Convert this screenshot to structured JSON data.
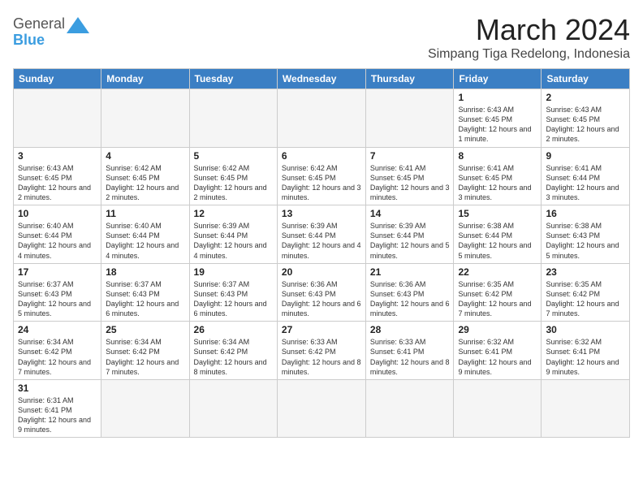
{
  "header": {
    "logo_general": "General",
    "logo_blue": "Blue",
    "month_title": "March 2024",
    "location": "Simpang Tiga Redelong, Indonesia"
  },
  "weekdays": [
    "Sunday",
    "Monday",
    "Tuesday",
    "Wednesday",
    "Thursday",
    "Friday",
    "Saturday"
  ],
  "weeks": [
    [
      {
        "day": "",
        "info": ""
      },
      {
        "day": "",
        "info": ""
      },
      {
        "day": "",
        "info": ""
      },
      {
        "day": "",
        "info": ""
      },
      {
        "day": "",
        "info": ""
      },
      {
        "day": "1",
        "info": "Sunrise: 6:43 AM\nSunset: 6:45 PM\nDaylight: 12 hours and 1 minute."
      },
      {
        "day": "2",
        "info": "Sunrise: 6:43 AM\nSunset: 6:45 PM\nDaylight: 12 hours and 2 minutes."
      }
    ],
    [
      {
        "day": "3",
        "info": "Sunrise: 6:43 AM\nSunset: 6:45 PM\nDaylight: 12 hours and 2 minutes."
      },
      {
        "day": "4",
        "info": "Sunrise: 6:42 AM\nSunset: 6:45 PM\nDaylight: 12 hours and 2 minutes."
      },
      {
        "day": "5",
        "info": "Sunrise: 6:42 AM\nSunset: 6:45 PM\nDaylight: 12 hours and 2 minutes."
      },
      {
        "day": "6",
        "info": "Sunrise: 6:42 AM\nSunset: 6:45 PM\nDaylight: 12 hours and 3 minutes."
      },
      {
        "day": "7",
        "info": "Sunrise: 6:41 AM\nSunset: 6:45 PM\nDaylight: 12 hours and 3 minutes."
      },
      {
        "day": "8",
        "info": "Sunrise: 6:41 AM\nSunset: 6:45 PM\nDaylight: 12 hours and 3 minutes."
      },
      {
        "day": "9",
        "info": "Sunrise: 6:41 AM\nSunset: 6:44 PM\nDaylight: 12 hours and 3 minutes."
      }
    ],
    [
      {
        "day": "10",
        "info": "Sunrise: 6:40 AM\nSunset: 6:44 PM\nDaylight: 12 hours and 4 minutes."
      },
      {
        "day": "11",
        "info": "Sunrise: 6:40 AM\nSunset: 6:44 PM\nDaylight: 12 hours and 4 minutes."
      },
      {
        "day": "12",
        "info": "Sunrise: 6:39 AM\nSunset: 6:44 PM\nDaylight: 12 hours and 4 minutes."
      },
      {
        "day": "13",
        "info": "Sunrise: 6:39 AM\nSunset: 6:44 PM\nDaylight: 12 hours and 4 minutes."
      },
      {
        "day": "14",
        "info": "Sunrise: 6:39 AM\nSunset: 6:44 PM\nDaylight: 12 hours and 5 minutes."
      },
      {
        "day": "15",
        "info": "Sunrise: 6:38 AM\nSunset: 6:44 PM\nDaylight: 12 hours and 5 minutes."
      },
      {
        "day": "16",
        "info": "Sunrise: 6:38 AM\nSunset: 6:43 PM\nDaylight: 12 hours and 5 minutes."
      }
    ],
    [
      {
        "day": "17",
        "info": "Sunrise: 6:37 AM\nSunset: 6:43 PM\nDaylight: 12 hours and 5 minutes."
      },
      {
        "day": "18",
        "info": "Sunrise: 6:37 AM\nSunset: 6:43 PM\nDaylight: 12 hours and 6 minutes."
      },
      {
        "day": "19",
        "info": "Sunrise: 6:37 AM\nSunset: 6:43 PM\nDaylight: 12 hours and 6 minutes."
      },
      {
        "day": "20",
        "info": "Sunrise: 6:36 AM\nSunset: 6:43 PM\nDaylight: 12 hours and 6 minutes."
      },
      {
        "day": "21",
        "info": "Sunrise: 6:36 AM\nSunset: 6:43 PM\nDaylight: 12 hours and 6 minutes."
      },
      {
        "day": "22",
        "info": "Sunrise: 6:35 AM\nSunset: 6:42 PM\nDaylight: 12 hours and 7 minutes."
      },
      {
        "day": "23",
        "info": "Sunrise: 6:35 AM\nSunset: 6:42 PM\nDaylight: 12 hours and 7 minutes."
      }
    ],
    [
      {
        "day": "24",
        "info": "Sunrise: 6:34 AM\nSunset: 6:42 PM\nDaylight: 12 hours and 7 minutes."
      },
      {
        "day": "25",
        "info": "Sunrise: 6:34 AM\nSunset: 6:42 PM\nDaylight: 12 hours and 7 minutes."
      },
      {
        "day": "26",
        "info": "Sunrise: 6:34 AM\nSunset: 6:42 PM\nDaylight: 12 hours and 8 minutes."
      },
      {
        "day": "27",
        "info": "Sunrise: 6:33 AM\nSunset: 6:42 PM\nDaylight: 12 hours and 8 minutes."
      },
      {
        "day": "28",
        "info": "Sunrise: 6:33 AM\nSunset: 6:41 PM\nDaylight: 12 hours and 8 minutes."
      },
      {
        "day": "29",
        "info": "Sunrise: 6:32 AM\nSunset: 6:41 PM\nDaylight: 12 hours and 9 minutes."
      },
      {
        "day": "30",
        "info": "Sunrise: 6:32 AM\nSunset: 6:41 PM\nDaylight: 12 hours and 9 minutes."
      }
    ],
    [
      {
        "day": "31",
        "info": "Sunrise: 6:31 AM\nSunset: 6:41 PM\nDaylight: 12 hours and 9 minutes."
      },
      {
        "day": "",
        "info": ""
      },
      {
        "day": "",
        "info": ""
      },
      {
        "day": "",
        "info": ""
      },
      {
        "day": "",
        "info": ""
      },
      {
        "day": "",
        "info": ""
      },
      {
        "day": "",
        "info": ""
      }
    ]
  ]
}
